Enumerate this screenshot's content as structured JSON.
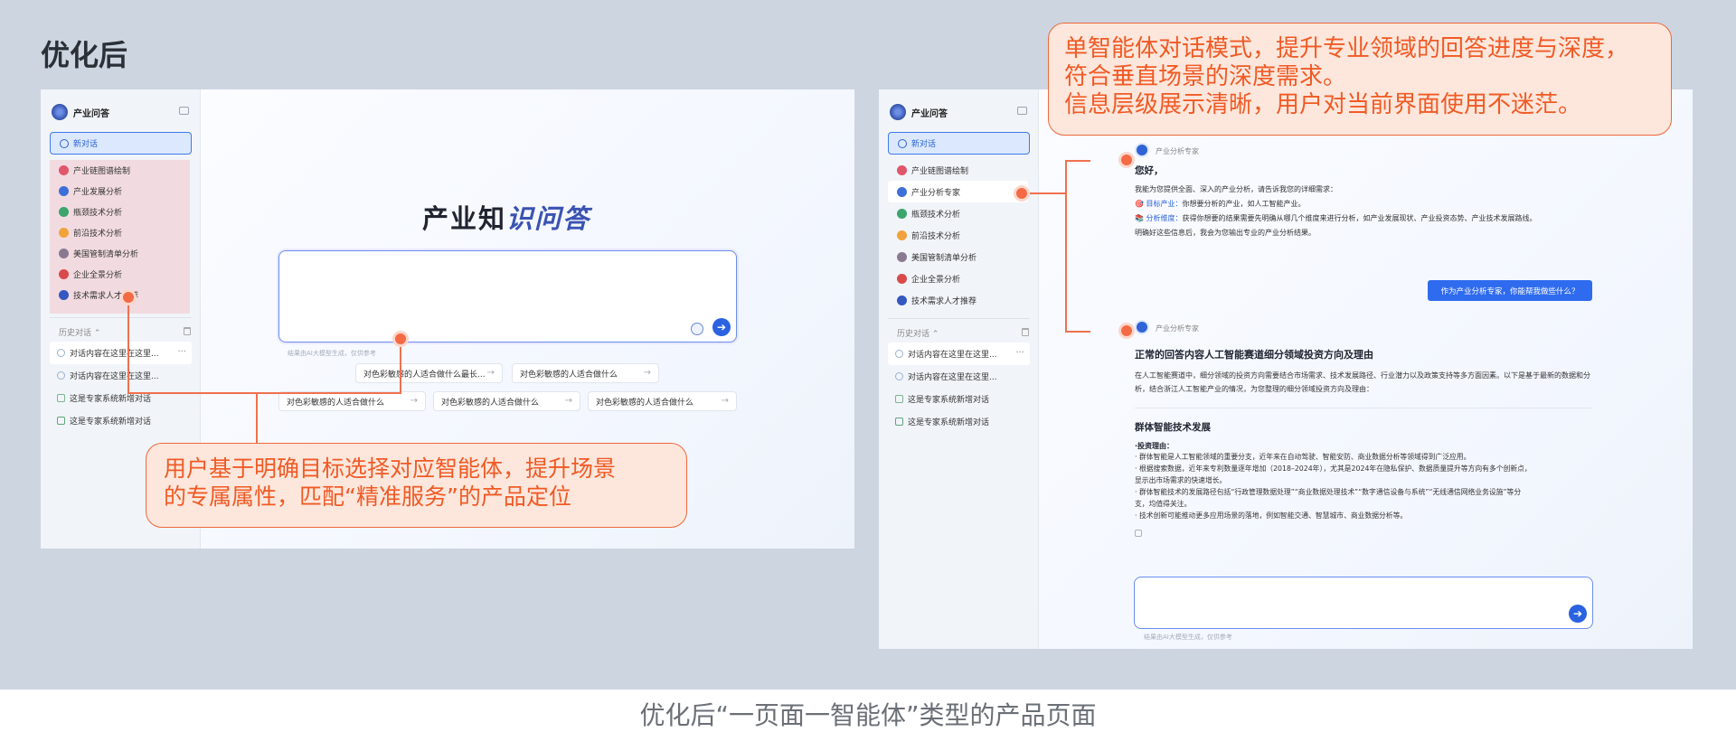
{
  "page": {
    "heading": "优化后",
    "caption": "优化后“一页面一智能体”类型的产品页面"
  },
  "app": {
    "name": "产业问答",
    "new_chat": "新对话",
    "agents": [
      {
        "label": "产业链图谱绘制",
        "color": "#e0566a"
      },
      {
        "label": "产业发展分析",
        "color": "#3d6fd8"
      },
      {
        "label": "瓶颈技术分析",
        "color": "#3ba56b"
      },
      {
        "label": "前沿技术分析",
        "color": "#f2a23c"
      },
      {
        "label": "美国管制清单分析",
        "color": "#8a7a8f"
      },
      {
        "label": "企业全景分析",
        "color": "#d94b4b"
      },
      {
        "label": "技术需求人才推荐",
        "color": "#3457c0"
      }
    ],
    "agents_b": [
      {
        "label": "产业链图谱绘制",
        "color": "#e0566a"
      },
      {
        "label": "产业分析专家",
        "color": "#3d6fd8"
      },
      {
        "label": "瓶颈技术分析",
        "color": "#3ba56b"
      },
      {
        "label": "前沿技术分析",
        "color": "#f2a23c"
      },
      {
        "label": "美国管制清单分析",
        "color": "#8a7a8f"
      },
      {
        "label": "企业全景分析",
        "color": "#d94b4b"
      },
      {
        "label": "技术需求人才推荐",
        "color": "#3457c0"
      }
    ],
    "history_label": "历史对话",
    "history": [
      {
        "label": "对话内容在这里在这里..."
      },
      {
        "label": "对话内容在这里在这里..."
      },
      {
        "label": "这是专家系统新增对话"
      },
      {
        "label": "这是专家系统新增对话"
      }
    ],
    "history_b": [
      {
        "label": "对话内容在这里在这里..."
      },
      {
        "label": "对话内容在这里在这里..."
      },
      {
        "label": "这是专家系统新增对话"
      },
      {
        "label": "这是专家系统新增对话"
      }
    ],
    "more": "···"
  },
  "home": {
    "title_a": "产业知",
    "title_b": "识问答",
    "disclaimer": "结果由AI大模型生成，仅供参考",
    "chips": [
      "对色彩敏感的人适合做什么最长...",
      "对色彩敏感的人适合做什么",
      "对色彩敏感的人适合做什么",
      "对色彩敏感的人适合做什么",
      "对色彩敏感的人适合做什么"
    ]
  },
  "chat": {
    "agent_name": "产业分析专家",
    "greeting": "您好，",
    "intro": "我能为您提供全面、深入的产业分析，请告诉我您的详细需求：",
    "goal_label": "目标产业：",
    "goal_text": "你想要分析的产业，如人工智能产业。",
    "dim_label": "分析维度：",
    "dim_text": "获得你想要的结果需要先明确从哪几个维度来进行分析，如产业发展现状、产业投资态势、产业技术发展路线。",
    "confirm": "明确好这些信息后，我会为您输出专业的产业分析结果。",
    "user_msg": "作为产业分析专家，你能帮我做些什么？",
    "answer_title": "正常的回答内容人工智能赛道细分领域投资方向及理由",
    "answer_intro": "在人工智能赛道中，细分领域的投资方向需要结合市场需求、技术发展路径、行业潜力以及政策支持等多方面因素。以下是基于最新的数据和分析，结合浙江人工智能产业的情况，为您整理的细分领域投资方向及理由：",
    "section_title": "群体智能技术发展",
    "reason_label": "·投资理由：",
    "bullets": [
      "· 群体智能是人工智能领域的重要分支，近年来在自动驾驶、智能安防、商业数据分析等领域得到广泛应用。",
      "· 根据搜索数据，近年来专利数量逐年增加（2018–2024年），尤其是2024年在隐私保护、数据质量提升等方向有多个创新点，",
      "显示出市场需求的快速增长。",
      "· 群体智能技术的发展路径包括“行政管理数据处理”“商业数据处理技术”“数字通信设备与系统”“无线通信网络业务设施”等分",
      "支，均值得关注。",
      "· 技术创新可能推动更多应用场景的落地，例如智能交通、智慧城市、商业数据分析等。"
    ],
    "disclaimer": "结果由AI大模型生成，仅供参考"
  },
  "callouts": {
    "left": [
      "用户基于明确目标选择对应智能体，提升场景",
      "的专属属性，匹配“精准服务”的产品定位"
    ],
    "right": [
      "单智能体对话模式，提升专业领域的回答进度与深度，",
      "符合垂直场景的深度需求。",
      "信息层级展示清晰，用户对当前界面使用不迷茫。"
    ]
  },
  "colors": {
    "accent": "#2a63d6",
    "callout": "#f05a25",
    "callout_bg": "#fde7dc"
  }
}
